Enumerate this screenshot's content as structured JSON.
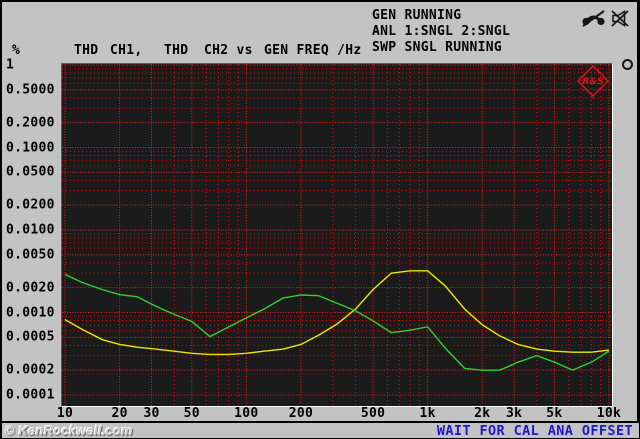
{
  "header": {
    "status_lines": [
      "GEN RUNNING",
      "ANL 1:SNGL 2:SNGL",
      "SWP SNGL RUNNING"
    ],
    "title_segments": [
      "%",
      "THD",
      "CH1,",
      "THD",
      "CH2 vs",
      "GEN FREQ /Hz"
    ],
    "icons": [
      "phone-muted-icon",
      "speaker-muted-icon",
      "busy-cursor-icon",
      "rohde-schwarz-logo"
    ]
  },
  "statusbar": {
    "watermark": "© KenRockwell.com",
    "message": "WAIT FOR CAL ANA OFFSET",
    "message_color": "#1a1acd"
  },
  "chart_data": {
    "type": "line",
    "title": "THD CH1, THD CH2 vs GEN FREQ /Hz",
    "xlabel": "GEN FREQ /Hz",
    "ylabel": "%",
    "x_scale": "log",
    "y_scale": "log",
    "xlim": [
      10,
      10000
    ],
    "ylim": [
      0.0001,
      1
    ],
    "grid": {
      "style": "dotted",
      "minor_color": "#bf1515",
      "major_color": "#f12020",
      "background": "#1b1b1b"
    },
    "legend_position": "none",
    "x_ticks": [
      {
        "value": 10,
        "label": "10"
      },
      {
        "value": 20,
        "label": "20"
      },
      {
        "value": 30,
        "label": "30"
      },
      {
        "value": 50,
        "label": "50"
      },
      {
        "value": 100,
        "label": "100"
      },
      {
        "value": 200,
        "label": "200"
      },
      {
        "value": 500,
        "label": "500"
      },
      {
        "value": 1000,
        "label": "1k"
      },
      {
        "value": 2000,
        "label": "2k"
      },
      {
        "value": 3000,
        "label": "3k"
      },
      {
        "value": 5000,
        "label": "5k"
      },
      {
        "value": 10000,
        "label": "10k"
      }
    ],
    "y_ticks": [
      {
        "value": 1,
        "label": "1"
      },
      {
        "value": 0.5,
        "label": "0.5000"
      },
      {
        "value": 0.2,
        "label": "0.2000"
      },
      {
        "value": 0.1,
        "label": "0.1000"
      },
      {
        "value": 0.05,
        "label": "0.0500"
      },
      {
        "value": 0.02,
        "label": "0.0200"
      },
      {
        "value": 0.01,
        "label": "0.0100"
      },
      {
        "value": 0.005,
        "label": "0.0050"
      },
      {
        "value": 0.002,
        "label": "0.0020"
      },
      {
        "value": 0.001,
        "label": "0.0010"
      },
      {
        "value": 0.0005,
        "label": "0.0005"
      },
      {
        "value": 0.0002,
        "label": "0.0002"
      },
      {
        "value": 0.0001,
        "label": "0.0001"
      }
    ],
    "x": [
      10,
      12.5,
      16,
      20,
      25,
      31.5,
      40,
      50,
      63,
      80,
      100,
      125,
      160,
      200,
      250,
      315,
      400,
      500,
      630,
      800,
      1000,
      1250,
      1600,
      2000,
      2500,
      3150,
      4000,
      5000,
      6300,
      8000,
      10000
    ],
    "series": [
      {
        "name": "THD CH1",
        "color": "#e8e800",
        "values": [
          0.00082,
          0.00062,
          0.00047,
          0.00041,
          0.00038,
          0.00036,
          0.00034,
          0.00032,
          0.00031,
          0.00031,
          0.00032,
          0.00034,
          0.00036,
          0.00041,
          0.00053,
          0.00072,
          0.0011,
          0.0019,
          0.003,
          0.0032,
          0.0032,
          0.0021,
          0.0011,
          0.00071,
          0.00052,
          0.00041,
          0.00036,
          0.00034,
          0.00033,
          0.00033,
          0.00035
        ]
      },
      {
        "name": "THD CH2",
        "color": "#30d030",
        "values": [
          0.0029,
          0.0023,
          0.0019,
          0.00165,
          0.00155,
          0.0012,
          0.00095,
          0.00078,
          0.00051,
          0.00067,
          0.00086,
          0.0011,
          0.0015,
          0.00163,
          0.0016,
          0.0013,
          0.00105,
          0.00079,
          0.00057,
          0.00061,
          0.00067,
          0.00037,
          0.00021,
          0.0002,
          0.0002,
          0.00025,
          0.0003,
          0.00025,
          0.0002,
          0.00025,
          0.00034
        ]
      }
    ]
  }
}
